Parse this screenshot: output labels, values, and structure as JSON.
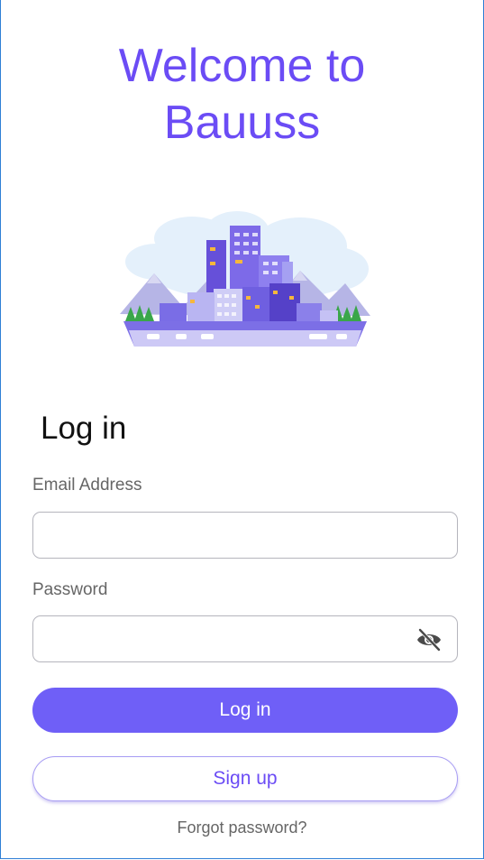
{
  "header": {
    "title_line1": "Welcome to",
    "title_line2": "Bauuss"
  },
  "hero": {
    "icon": "city-skyline-illustration"
  },
  "login": {
    "heading": "Log in",
    "email": {
      "label": "Email Address",
      "value": "",
      "placeholder": ""
    },
    "password": {
      "label": "Password",
      "value": "",
      "placeholder": "",
      "toggle_icon": "eye-off-icon"
    },
    "login_button": "Log in",
    "signup_button": "Sign up",
    "forgot_link": "Forgot password?"
  },
  "colors": {
    "accent": "#6b4cf5",
    "button_fill": "#6f5ff7",
    "label_gray": "#666666",
    "input_border": "#b5b5bd"
  }
}
